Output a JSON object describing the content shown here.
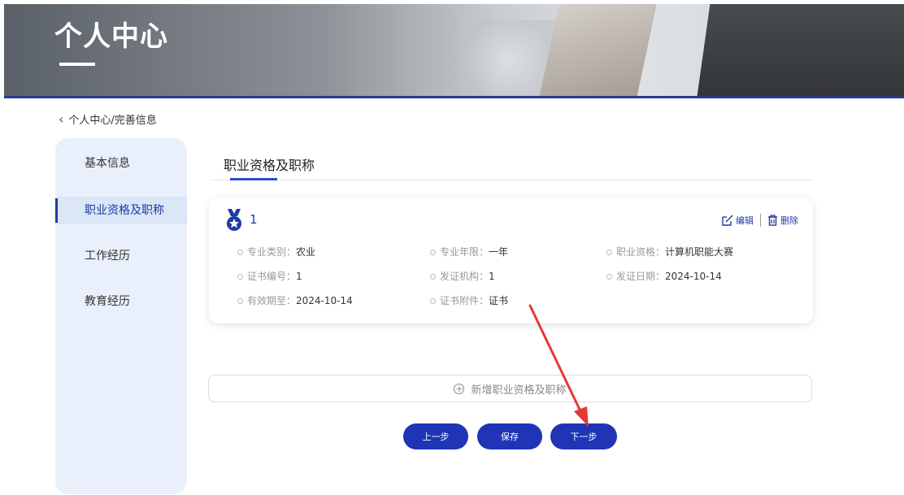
{
  "header": {
    "title": "个人中心"
  },
  "breadcrumb": {
    "text": "个人中心/完善信息"
  },
  "sidebar": {
    "items": [
      {
        "label": "基本信息"
      },
      {
        "label": "职业资格及职称"
      },
      {
        "label": "工作经历"
      },
      {
        "label": "教育经历"
      }
    ],
    "active_index": 1
  },
  "main": {
    "section_title": "职业资格及职称",
    "card": {
      "number": "1",
      "edit_label": "编辑",
      "delete_label": "删除",
      "fields": [
        {
          "label": "专业类别：",
          "value": "农业"
        },
        {
          "label": "专业年限：",
          "value": "一年"
        },
        {
          "label": "职业资格：",
          "value": "计算机职能大赛"
        },
        {
          "label": "证书编号：",
          "value": "1"
        },
        {
          "label": "发证机构：",
          "value": "1"
        },
        {
          "label": "发证日期：",
          "value": "2024-10-14"
        },
        {
          "label": "有效期至：",
          "value": "2024-10-14"
        },
        {
          "label": "证书附件：",
          "value": "证书"
        }
      ]
    },
    "add_label": "新增职业资格及职称"
  },
  "buttons": {
    "prev": "上一步",
    "save": "保存",
    "next": "下一步"
  },
  "colors": {
    "primary": "#1f35b5",
    "sidebar_bg": "#e9f0fb",
    "annotation_arrow": "#e53935"
  }
}
